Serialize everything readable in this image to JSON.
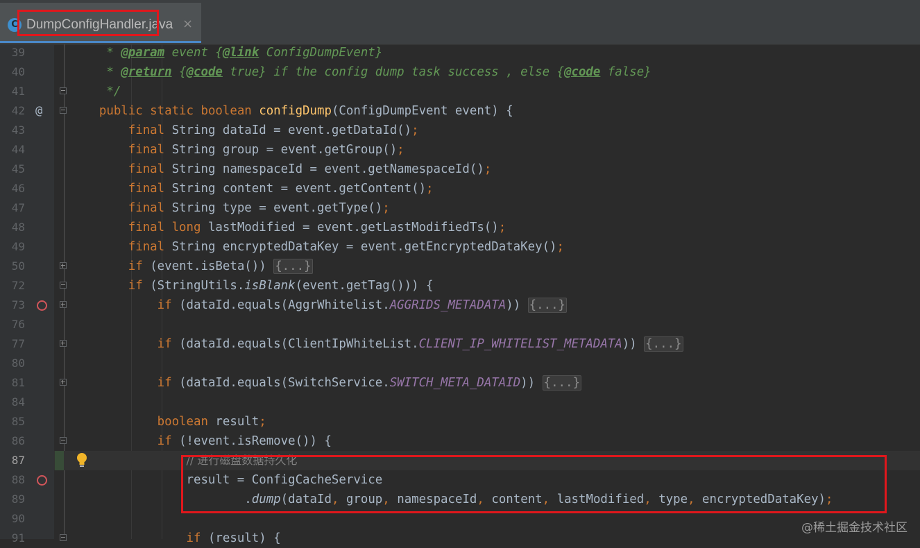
{
  "tab": {
    "label": "DumpConfigHandler.java",
    "close": "×",
    "icon_letter": "C",
    "icon": "class-icon"
  },
  "lines": [
    {
      "num": "39",
      "tokens": [
        {
          "t": "     * ",
          "c": "doc"
        },
        {
          "t": "@param",
          "c": "dtag"
        },
        {
          "t": " event {",
          "c": "doc"
        },
        {
          "t": "@link",
          "c": "dtag"
        },
        {
          "t": " ConfigDumpEvent}",
          "c": "doc"
        }
      ]
    },
    {
      "num": "40",
      "tokens": [
        {
          "t": "     * ",
          "c": "doc"
        },
        {
          "t": "@return",
          "c": "dtag"
        },
        {
          "t": " {",
          "c": "doc"
        },
        {
          "t": "@code",
          "c": "dtag"
        },
        {
          "t": " true} if the config dump task success , else {",
          "c": "doc"
        },
        {
          "t": "@code",
          "c": "dtag"
        },
        {
          "t": " false}",
          "c": "doc"
        }
      ]
    },
    {
      "num": "41",
      "fold": "minus",
      "tokens": [
        {
          "t": "     */",
          "c": "doc"
        }
      ]
    },
    {
      "num": "42",
      "at": "@",
      "fold": "minus",
      "tokens": [
        {
          "t": "    "
        },
        {
          "t": "public static boolean ",
          "c": "kw"
        },
        {
          "t": "configDump",
          "c": "fn"
        },
        {
          "t": "(ConfigDumpEvent event) {"
        }
      ]
    },
    {
      "num": "43",
      "tokens": [
        {
          "t": "        "
        },
        {
          "t": "final ",
          "c": "kw"
        },
        {
          "t": "String dataId = event.getDataId()"
        },
        {
          "t": ";",
          "c": "kw"
        }
      ]
    },
    {
      "num": "44",
      "tokens": [
        {
          "t": "        "
        },
        {
          "t": "final ",
          "c": "kw"
        },
        {
          "t": "String group = event.getGroup()"
        },
        {
          "t": ";",
          "c": "kw"
        }
      ]
    },
    {
      "num": "45",
      "tokens": [
        {
          "t": "        "
        },
        {
          "t": "final ",
          "c": "kw"
        },
        {
          "t": "String namespaceId = event.getNamespaceId()"
        },
        {
          "t": ";",
          "c": "kw"
        }
      ]
    },
    {
      "num": "46",
      "tokens": [
        {
          "t": "        "
        },
        {
          "t": "final ",
          "c": "kw"
        },
        {
          "t": "String content = event.getContent()"
        },
        {
          "t": ";",
          "c": "kw"
        }
      ]
    },
    {
      "num": "47",
      "tokens": [
        {
          "t": "        "
        },
        {
          "t": "final ",
          "c": "kw"
        },
        {
          "t": "String type = event.getType()"
        },
        {
          "t": ";",
          "c": "kw"
        }
      ]
    },
    {
      "num": "48",
      "tokens": [
        {
          "t": "        "
        },
        {
          "t": "final long ",
          "c": "kw"
        },
        {
          "t": "lastModified = event.getLastModifiedTs()"
        },
        {
          "t": ";",
          "c": "kw"
        }
      ]
    },
    {
      "num": "49",
      "tokens": [
        {
          "t": "        "
        },
        {
          "t": "final ",
          "c": "kw"
        },
        {
          "t": "String encryptedDataKey = event.getEncryptedDataKey()"
        },
        {
          "t": ";",
          "c": "kw"
        }
      ]
    },
    {
      "num": "50",
      "fold": "plus",
      "tokens": [
        {
          "t": "        "
        },
        {
          "t": "if ",
          "c": "kw"
        },
        {
          "t": "(event.isBeta()) "
        },
        {
          "t": "{...}",
          "c": "fold"
        }
      ]
    },
    {
      "num": "72",
      "fold": "minus",
      "tokens": [
        {
          "t": "        "
        },
        {
          "t": "if ",
          "c": "kw"
        },
        {
          "t": "(StringUtils."
        },
        {
          "t": "isBlank",
          "c": "ital"
        },
        {
          "t": "(event.getTag())) {"
        }
      ]
    },
    {
      "num": "73",
      "bp": true,
      "fold": "plus",
      "tokens": [
        {
          "t": "            "
        },
        {
          "t": "if ",
          "c": "kw"
        },
        {
          "t": "(dataId.equals(AggrWhitelist."
        },
        {
          "t": "AGGRIDS_METADATA",
          "c": "cst"
        },
        {
          "t": ")) "
        },
        {
          "t": "{...}",
          "c": "fold"
        }
      ]
    },
    {
      "num": "76",
      "tokens": []
    },
    {
      "num": "77",
      "fold": "plus",
      "tokens": [
        {
          "t": "            "
        },
        {
          "t": "if ",
          "c": "kw"
        },
        {
          "t": "(dataId.equals(ClientIpWhiteList."
        },
        {
          "t": "CLIENT_IP_WHITELIST_METADATA",
          "c": "cst"
        },
        {
          "t": ")) "
        },
        {
          "t": "{...}",
          "c": "fold"
        }
      ]
    },
    {
      "num": "80",
      "tokens": []
    },
    {
      "num": "81",
      "fold": "plus",
      "tokens": [
        {
          "t": "            "
        },
        {
          "t": "if ",
          "c": "kw"
        },
        {
          "t": "(dataId.equals(SwitchService."
        },
        {
          "t": "SWITCH_META_DATAID",
          "c": "cst"
        },
        {
          "t": ")) "
        },
        {
          "t": "{...}",
          "c": "fold"
        }
      ]
    },
    {
      "num": "84",
      "tokens": []
    },
    {
      "num": "85",
      "tokens": [
        {
          "t": "            "
        },
        {
          "t": "boolean ",
          "c": "kw"
        },
        {
          "t": "result"
        },
        {
          "t": ";",
          "c": "kw"
        }
      ]
    },
    {
      "num": "86",
      "fold": "minus",
      "tokens": [
        {
          "t": "            "
        },
        {
          "t": "if ",
          "c": "kw"
        },
        {
          "t": "(!event.isRemove()) {"
        }
      ]
    },
    {
      "num": "87",
      "current": true,
      "bulb": true,
      "tokens": [
        {
          "t": "                "
        },
        {
          "t": "// 进行磁盘数据持久化",
          "c": "cmt"
        }
      ]
    },
    {
      "num": "88",
      "bp": true,
      "tokens": [
        {
          "t": "                result = ConfigCacheService"
        }
      ]
    },
    {
      "num": "89",
      "tokens": [
        {
          "t": "                        ."
        },
        {
          "t": "dump",
          "c": "ital"
        },
        {
          "t": "(dataId"
        },
        {
          "t": ", ",
          "c": "kw"
        },
        {
          "t": "group"
        },
        {
          "t": ", ",
          "c": "kw"
        },
        {
          "t": "namespaceId"
        },
        {
          "t": ", ",
          "c": "kw"
        },
        {
          "t": "content"
        },
        {
          "t": ", ",
          "c": "kw"
        },
        {
          "t": "lastModified"
        },
        {
          "t": ", ",
          "c": "kw"
        },
        {
          "t": "type"
        },
        {
          "t": ", ",
          "c": "kw"
        },
        {
          "t": "encryptedDataKey)"
        },
        {
          "t": ";",
          "c": "kw"
        }
      ]
    },
    {
      "num": "90",
      "tokens": []
    },
    {
      "num": "91",
      "fold": "minus",
      "tokens": [
        {
          "t": "                "
        },
        {
          "t": "if ",
          "c": "kw"
        },
        {
          "t": "(result) {"
        }
      ]
    }
  ],
  "colors": {
    "keyword": "#cc7832",
    "method": "#ffc66d",
    "doc": "#629755",
    "constant": "#9876aa",
    "comment": "#808080",
    "text": "#a9b7c6",
    "highlight": "#e0171c"
  },
  "watermark": "@稀土掘金技术社区"
}
